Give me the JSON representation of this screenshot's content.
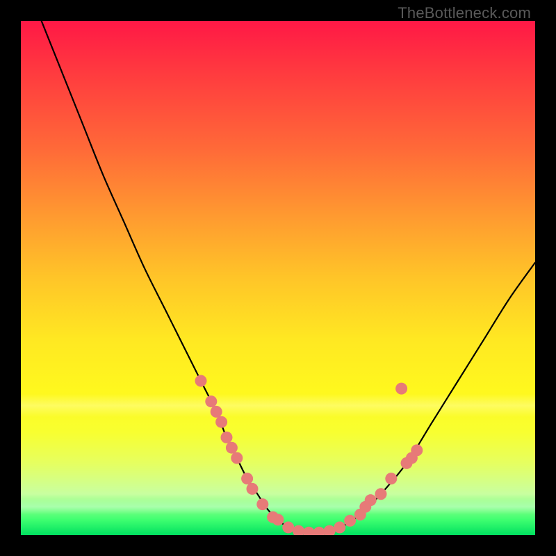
{
  "watermark": "TheBottleneck.com",
  "colors": {
    "curve_stroke": "#000000",
    "marker_fill": "#e77a78",
    "marker_stroke": "#d86868"
  },
  "chart_data": {
    "type": "line",
    "title": "",
    "xlabel": "",
    "ylabel": "",
    "xlim": [
      0,
      100
    ],
    "ylim": [
      0,
      100
    ],
    "series": [
      {
        "name": "curve",
        "x": [
          4,
          8,
          12,
          16,
          20,
          24,
          28,
          32,
          35,
          38,
          40,
          42,
          44,
          46,
          48,
          50,
          52,
          55,
          58,
          62,
          66,
          70,
          75,
          80,
          85,
          90,
          95,
          100
        ],
        "y": [
          100,
          90,
          80,
          70,
          61,
          52,
          44,
          36,
          30,
          24,
          19,
          15,
          11,
          8,
          5,
          3,
          1.5,
          0.5,
          0.5,
          1.5,
          4,
          8,
          14,
          22,
          30,
          38,
          46,
          53
        ]
      }
    ],
    "markers": {
      "name": "highlighted-points",
      "points": [
        {
          "x": 35,
          "y": 30
        },
        {
          "x": 37,
          "y": 26
        },
        {
          "x": 38,
          "y": 24
        },
        {
          "x": 39,
          "y": 22
        },
        {
          "x": 40,
          "y": 19
        },
        {
          "x": 41,
          "y": 17
        },
        {
          "x": 42,
          "y": 15
        },
        {
          "x": 44,
          "y": 11
        },
        {
          "x": 45,
          "y": 9
        },
        {
          "x": 47,
          "y": 6
        },
        {
          "x": 49,
          "y": 3.5
        },
        {
          "x": 50,
          "y": 3
        },
        {
          "x": 52,
          "y": 1.5
        },
        {
          "x": 54,
          "y": 0.8
        },
        {
          "x": 56,
          "y": 0.5
        },
        {
          "x": 58,
          "y": 0.5
        },
        {
          "x": 60,
          "y": 0.8
        },
        {
          "x": 62,
          "y": 1.5
        },
        {
          "x": 64,
          "y": 2.8
        },
        {
          "x": 66,
          "y": 4
        },
        {
          "x": 67,
          "y": 5.5
        },
        {
          "x": 68,
          "y": 6.8
        },
        {
          "x": 70,
          "y": 8
        },
        {
          "x": 72,
          "y": 11
        },
        {
          "x": 75,
          "y": 14
        },
        {
          "x": 76,
          "y": 15
        },
        {
          "x": 77,
          "y": 16.5
        },
        {
          "x": 74,
          "y": 28.5
        }
      ]
    }
  }
}
